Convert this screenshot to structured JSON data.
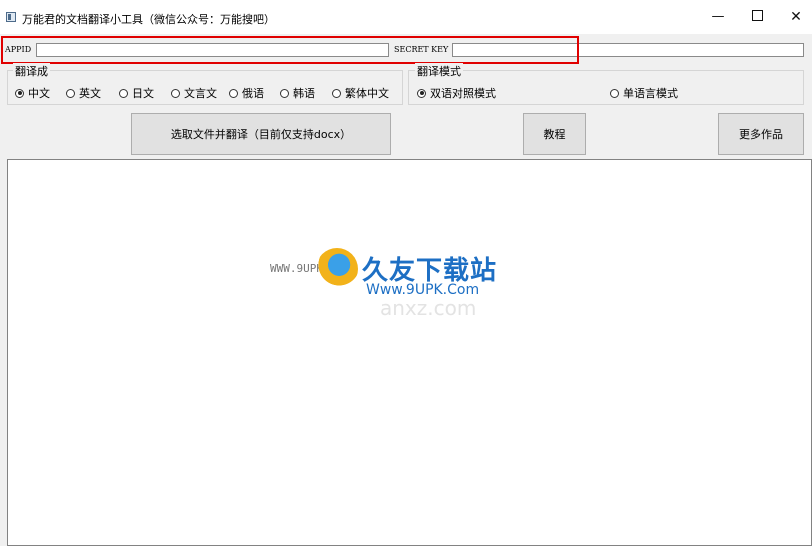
{
  "window": {
    "title": "万能君的文档翻译小工具（微信公众号：万能搜吧）",
    "minimize": "—",
    "close": "✕"
  },
  "credentials": {
    "appid_label": "APPID",
    "appid_value": "",
    "secret_label": "SECRET KEY",
    "secret_value": ""
  },
  "target_language": {
    "group_title": "翻译成",
    "options": [
      "中文",
      "英文",
      "日文",
      "文言文",
      "俄语",
      "韩语",
      "繁体中文"
    ],
    "selected": "中文"
  },
  "mode": {
    "group_title": "翻译模式",
    "options": [
      "双语对照模式",
      "单语言模式"
    ],
    "selected": "双语对照模式"
  },
  "buttons": {
    "select_translate": "选取文件并翻译（目前仅支持docx）",
    "tutorial": "教程",
    "more_works": "更多作品"
  },
  "output": {
    "text": ""
  },
  "watermark": {
    "url_left": "WWW.9UPK.com",
    "brand": "久友下载站",
    "url_right": "Www.9UPK.Com",
    "ghost": "anxz.com"
  },
  "colors": {
    "highlight": "#e00000",
    "brand_blue": "#1d6fc4"
  }
}
